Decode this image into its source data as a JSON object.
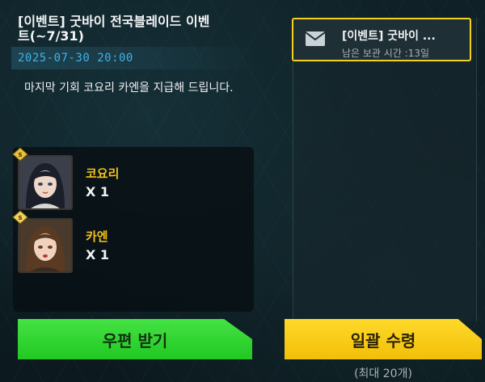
{
  "mail_detail": {
    "title": "[이벤트] 굿바이 전국블레이드 이벤트(~7/31)",
    "date": "2025-07-30 20:00",
    "body": "마지막 기회  코요리 카엔을 지급해 드립니다."
  },
  "rewards": [
    {
      "name": "코요리",
      "quantity": "X 1",
      "icon": "character-portrait-koyori"
    },
    {
      "name": "카엔",
      "quantity": "X 1",
      "icon": "character-portrait-kaen"
    }
  ],
  "mail_list": [
    {
      "title": "[이벤트] 굿바이 ...",
      "subtitle": "남은 보관 시간 :13일",
      "icon": "envelope-icon",
      "selected": true
    }
  ],
  "buttons": {
    "receive_mail": "우편 받기",
    "receive_all": "일괄 수령",
    "receive_all_limit": "(최대 20개)"
  },
  "colors": {
    "accent_blue": "#3fb3e6",
    "reward_name": "#f3c21c",
    "green_button": "#2bd12b",
    "yellow_button": "#f7c812",
    "selected_border": "#f4d21c"
  }
}
